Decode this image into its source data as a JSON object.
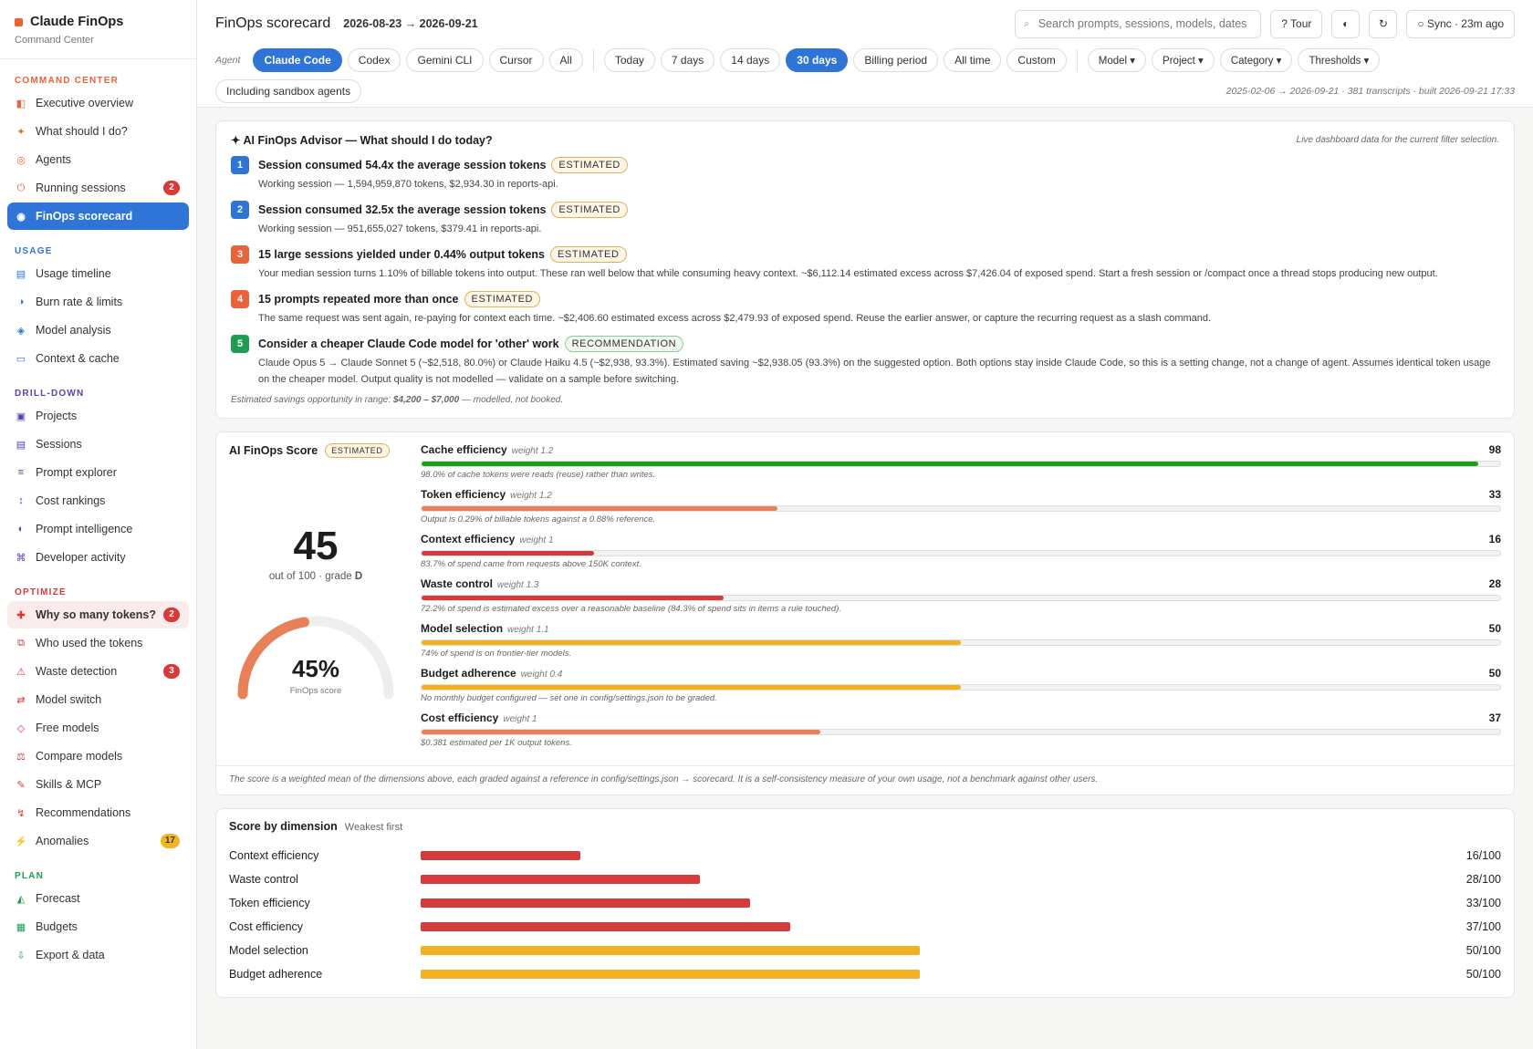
{
  "brand": {
    "title": "Claude FinOps",
    "subtitle": "Command Center"
  },
  "sidebar": {
    "sections": [
      {
        "title": "COMMAND CENTER",
        "color": "#e9623a",
        "items": [
          {
            "label": "Executive overview",
            "icon": "dashboard-icon",
            "glyph": "◧",
            "icolor": "#e9623a"
          },
          {
            "label": "What should I do?",
            "icon": "sparkle-icon",
            "glyph": "✦",
            "icolor": "#e9623a"
          },
          {
            "label": "Agents",
            "icon": "agents-icon",
            "glyph": "◎",
            "icolor": "#e9623a"
          },
          {
            "label": "Running sessions",
            "icon": "power-icon",
            "glyph": "⏻",
            "icolor": "#e9623a",
            "badge": "2",
            "badgeColor": "#d83a3a"
          },
          {
            "label": "FinOps scorecard",
            "icon": "scorecard-icon",
            "glyph": "◉",
            "icolor": "#fff",
            "active": true
          }
        ]
      },
      {
        "title": "USAGE",
        "color": "#2f74d7",
        "items": [
          {
            "label": "Usage timeline",
            "icon": "timeline-icon",
            "glyph": "▤",
            "icolor": "#2f74d7"
          },
          {
            "label": "Burn rate & limits",
            "icon": "burn-rate-icon",
            "glyph": "◑",
            "icolor": "#2f74d7"
          },
          {
            "label": "Model analysis",
            "icon": "model-analysis-icon",
            "glyph": "◈",
            "icolor": "#2f74d7"
          },
          {
            "label": "Context & cache",
            "icon": "context-cache-icon",
            "glyph": "▭",
            "icolor": "#2f74d7"
          }
        ]
      },
      {
        "title": "DRILL-DOWN",
        "color": "#5b3fb6",
        "items": [
          {
            "label": "Projects",
            "icon": "projects-icon",
            "glyph": "▣",
            "icolor": "#5b3fb6"
          },
          {
            "label": "Sessions",
            "icon": "sessions-icon",
            "glyph": "▤",
            "icolor": "#5b3fb6"
          },
          {
            "label": "Prompt explorer",
            "icon": "prompt-explorer-icon",
            "glyph": "≡",
            "icolor": "#5b3fb6"
          },
          {
            "label": "Cost rankings",
            "icon": "cost-rankings-icon",
            "glyph": "↕",
            "icolor": "#5b3fb6"
          },
          {
            "label": "Prompt intelligence",
            "icon": "prompt-intelligence-icon",
            "glyph": "◐",
            "icolor": "#5b3fb6"
          },
          {
            "label": "Developer activity",
            "icon": "developer-icon",
            "glyph": "⌘",
            "icolor": "#5b3fb6"
          }
        ]
      },
      {
        "title": "OPTIMIZE",
        "color": "#d83a3a",
        "items": [
          {
            "label": "Why so many tokens?",
            "icon": "cross-icon",
            "glyph": "✚",
            "icolor": "#d83a3a",
            "badge": "2",
            "badgeColor": "#d83a3a",
            "hl": true
          },
          {
            "label": "Who used the tokens",
            "icon": "users-icon",
            "glyph": "⧉",
            "icolor": "#d83a3a"
          },
          {
            "label": "Waste detection",
            "icon": "warning-icon",
            "glyph": "⚠",
            "icolor": "#d83a3a",
            "badge": "3",
            "badgeColor": "#d83a3a"
          },
          {
            "label": "Model switch",
            "icon": "switch-icon",
            "glyph": "⇄",
            "icolor": "#d83a3a"
          },
          {
            "label": "Free models",
            "icon": "diamond-icon",
            "glyph": "◇",
            "icolor": "#d83a3a"
          },
          {
            "label": "Compare models",
            "icon": "compare-icon",
            "glyph": "⚖",
            "icolor": "#d83a3a"
          },
          {
            "label": "Skills & MCP",
            "icon": "skills-icon",
            "glyph": "✎",
            "icolor": "#d83a3a"
          },
          {
            "label": "Recommendations",
            "icon": "recommendations-icon",
            "glyph": "↯",
            "icolor": "#d83a3a"
          },
          {
            "label": "Anomalies",
            "icon": "bolt-icon",
            "glyph": "⚡",
            "icolor": "#f0a500",
            "badge": "17",
            "badgeColor": "#f0b428",
            "badgeText": "#333"
          }
        ]
      },
      {
        "title": "PLAN",
        "color": "#1f9d55",
        "items": [
          {
            "label": "Forecast",
            "icon": "forecast-icon",
            "glyph": "◭",
            "icolor": "#1f9d55"
          },
          {
            "label": "Budgets",
            "icon": "budgets-icon",
            "glyph": "▦",
            "icolor": "#1f9d55"
          },
          {
            "label": "Export & data",
            "icon": "export-icon",
            "glyph": "⇩",
            "icolor": "#1f9d55"
          }
        ]
      }
    ]
  },
  "header": {
    "title": "FinOps scorecard",
    "range": "2026-08-23 → 2026-09-21",
    "search_placeholder": "Search prompts, sessions, models, dates",
    "tour": "? Tour",
    "theme_icon": "◐",
    "refresh_icon": "↻",
    "sync": "○ Sync · 23m ago"
  },
  "filters": {
    "agent_label": "Agent",
    "agents": [
      {
        "label": "Claude Code",
        "on": true
      },
      {
        "label": "Codex"
      },
      {
        "label": "Gemini CLI"
      },
      {
        "label": "Cursor"
      },
      {
        "label": "All"
      }
    ],
    "ranges": [
      {
        "label": "Today"
      },
      {
        "label": "7 days"
      },
      {
        "label": "14 days"
      },
      {
        "label": "30 days",
        "on": true
      },
      {
        "label": "Billing period"
      },
      {
        "label": "All time"
      },
      {
        "label": "Custom"
      }
    ],
    "dropdowns": [
      "Model ▾",
      "Project ▾",
      "Category ▾",
      "Thresholds ▾"
    ],
    "sandbox": "Including sandbox agents",
    "meta": "2025-02-06 → 2026-09-21 · 381 transcripts · built 2026-09-21 17:33"
  },
  "advisor": {
    "title": "✦ AI FinOps Advisor — What should I do today?",
    "note": "Live dashboard data for the current filter selection.",
    "items": [
      {
        "n": "1",
        "color": "#2f74d7",
        "title": "Session consumed 54.4x the average session tokens",
        "tag": "ESTIMATED",
        "desc": "Working session — 1,594,959,870 tokens, $2,934.30 in reports-api."
      },
      {
        "n": "2",
        "color": "#2f74d7",
        "title": "Session consumed 32.5x the average session tokens",
        "tag": "ESTIMATED",
        "desc": "Working session — 951,655,027 tokens, $379.41 in reports-api."
      },
      {
        "n": "3",
        "color": "#e9623a",
        "title": "15 large sessions yielded under 0.44% output tokens",
        "tag": "ESTIMATED",
        "desc": "Your median session turns 1.10% of billable tokens into output. These ran well below that while consuming heavy context. ~$6,112.14 estimated excess across $7,426.04 of exposed spend. Start a fresh session or /compact once a thread stops producing new output."
      },
      {
        "n": "4",
        "color": "#e9623a",
        "title": "15 prompts repeated more than once",
        "tag": "ESTIMATED",
        "desc": "The same request was sent again, re-paying for context each time. ~$2,406.60 estimated excess across $2,479.93 of exposed spend. Reuse the earlier answer, or capture the recurring request as a slash command."
      },
      {
        "n": "5",
        "color": "#1f9d55",
        "title": "Consider a cheaper Claude Code model for 'other' work",
        "tag": "RECOMMENDATION",
        "green": true,
        "desc": "Claude Opus 5 → Claude Sonnet 5 (~$2,518, 80.0%) or Claude Haiku 4.5 (~$2,938, 93.3%). Estimated saving ~$2,938.05 (93.3%) on the suggested option. Both options stay inside Claude Code, so this is a setting change, not a change of agent. Assumes identical token usage on the cheaper model. Output quality is not modelled — validate on a sample before switching."
      }
    ],
    "foot_prefix": "Estimated savings opportunity in range: ",
    "foot_value": "$4,200 – $7,000",
    "foot_suffix": " — modelled, not booked."
  },
  "score": {
    "title": "AI FinOps Score",
    "tag": "ESTIMATED",
    "value": "45",
    "sub_prefix": "out of 100 · grade ",
    "grade": "D",
    "pct_label": "45%",
    "pct": 45,
    "gauge_label": "FinOps score",
    "dimensions": [
      {
        "name": "Cache efficiency",
        "weight": "weight 1.2",
        "value": "98",
        "pct": 98,
        "color": "#1aa01a",
        "note": "98.0% of cache tokens were reads (reuse) rather than writes."
      },
      {
        "name": "Token efficiency",
        "weight": "weight 1.2",
        "value": "33",
        "pct": 33,
        "color": "#e8805a",
        "note": "Output is 0.29% of billable tokens against a 0.88% reference."
      },
      {
        "name": "Context efficiency",
        "weight": "weight 1",
        "value": "16",
        "pct": 16,
        "color": "#d63a3a",
        "note": "83.7% of spend came from requests above 150K context."
      },
      {
        "name": "Waste control",
        "weight": "weight 1.3",
        "value": "28",
        "pct": 28,
        "color": "#d63a3a",
        "note": "72.2% of spend is estimated excess over a reasonable baseline (84.3% of spend sits in items a rule touched)."
      },
      {
        "name": "Model selection",
        "weight": "weight 1.1",
        "value": "50",
        "pct": 50,
        "color": "#f5b020",
        "note": "74% of spend is on frontier-tier models."
      },
      {
        "name": "Budget adherence",
        "weight": "weight 0.4",
        "value": "50",
        "pct": 50,
        "color": "#f5b020",
        "note": "No monthly budget configured — set one in config/settings.json to be graded."
      },
      {
        "name": "Cost efficiency",
        "weight": "weight 1",
        "value": "37",
        "pct": 37,
        "color": "#e8805a",
        "note": "$0.381 estimated per 1K output tokens."
      }
    ],
    "foot": "The score is a weighted mean of the dimensions above, each graded against a reference in config/settings.json → scorecard. It is a self-consistency measure of your own usage, not a benchmark against other users."
  },
  "by_dimension": {
    "title": "Score by dimension",
    "sub": "Weakest first",
    "rows": [
      {
        "name": "Context efficiency",
        "value": "16/100",
        "pct": 16,
        "color": "#d63a3a"
      },
      {
        "name": "Waste control",
        "value": "28/100",
        "pct": 28,
        "color": "#d63a3a"
      },
      {
        "name": "Token efficiency",
        "value": "33/100",
        "pct": 33,
        "color": "#d63a3a"
      },
      {
        "name": "Cost efficiency",
        "value": "37/100",
        "pct": 37,
        "color": "#d63a3a"
      },
      {
        "name": "Model selection",
        "value": "50/100",
        "pct": 50,
        "color": "#f5b020"
      },
      {
        "name": "Budget adherence",
        "value": "50/100",
        "pct": 50,
        "color": "#f5b020"
      }
    ]
  }
}
